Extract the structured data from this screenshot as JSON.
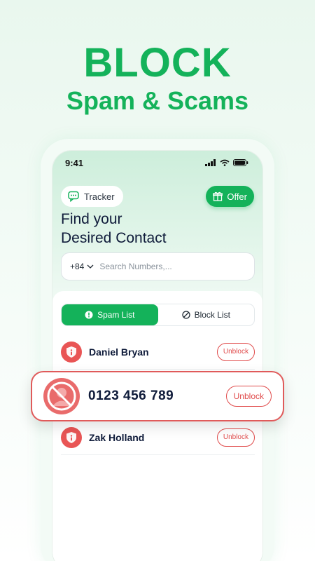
{
  "hero": {
    "title": "BLOCK",
    "subtitle": "Spam & Scams"
  },
  "status_bar": {
    "time": "9:41"
  },
  "header": {
    "tracker_label": "Tracker",
    "offer_label": "Offer",
    "headline_line1": "Find your",
    "headline_line2": "Desired Contact"
  },
  "search": {
    "country_code": "+84",
    "placeholder": "Search Numbers,..."
  },
  "tabs": [
    {
      "label": "Spam List",
      "active": true
    },
    {
      "label": "Block List",
      "active": false
    }
  ],
  "contacts": [
    {
      "name": "Daniel Bryan",
      "action": "Unblock"
    },
    {
      "name": "Zak Holland",
      "action": "Unblock"
    }
  ],
  "highlight": {
    "number": "0123 456 789",
    "action": "Unblock"
  },
  "colors": {
    "accent": "#14b25a",
    "danger": "#e04b4b",
    "text_dark": "#0f1b3a"
  },
  "icons": [
    "chat-icon",
    "gift-icon",
    "chevron-down-icon",
    "alert-icon",
    "block-icon",
    "shield-icon",
    "blocked-user-icon",
    "signal-icon",
    "wifi-icon",
    "battery-icon"
  ]
}
